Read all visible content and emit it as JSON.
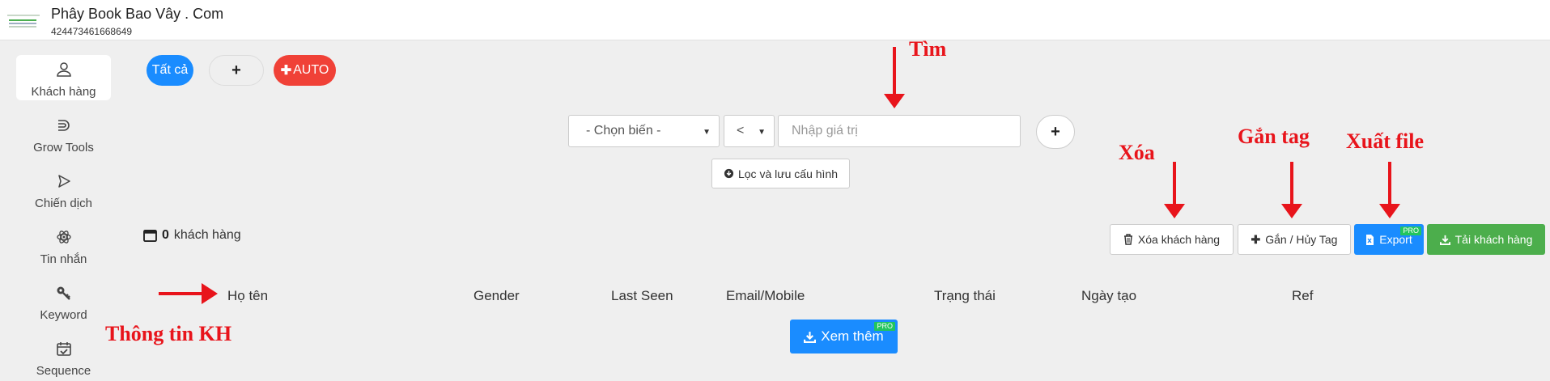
{
  "header": {
    "title": "Phây Book Bao Vây . Com",
    "page_id": "424473461668649"
  },
  "sidebar": {
    "items": [
      {
        "label": "Khách hàng",
        "icon": "user-icon",
        "active": true
      },
      {
        "label": "Grow Tools",
        "icon": "magnet-icon"
      },
      {
        "label": "Chiến dịch",
        "icon": "send-icon"
      },
      {
        "label": "Tin nhắn",
        "icon": "atom-icon"
      },
      {
        "label": "Keyword",
        "icon": "key-icon"
      },
      {
        "label": "Sequence",
        "icon": "calendar-check-icon"
      }
    ]
  },
  "segments": {
    "all": "Tất cả",
    "add": "+",
    "auto": "AUTO"
  },
  "filter": {
    "variable_placeholder": "- Chọn biến -",
    "operator": "<",
    "value_placeholder": "Nhập giá trị",
    "add": "+",
    "save_label": "Lọc và lưu cấu hình"
  },
  "summary": {
    "count": "0",
    "unit": "khách hàng"
  },
  "actions": {
    "delete": "Xóa khách hàng",
    "tag": "Gắn / Hủy Tag",
    "export": "Export",
    "export_badge": "PRO",
    "download": "Tải khách hàng"
  },
  "table": {
    "columns": [
      "Họ tên",
      "Gender",
      "Last Seen",
      "Email/Mobile",
      "Trạng thái",
      "Ngày tạo",
      "Ref"
    ]
  },
  "load_more": {
    "label": "Xem thêm",
    "badge": "PRO"
  },
  "annotations": {
    "search": "Tìm",
    "delete": "Xóa",
    "tag": "Gắn tag",
    "export": "Xuất file",
    "customer_info": "Thông tin KH"
  },
  "colors": {
    "primary": "#1a8cff",
    "danger": "#f04137",
    "success": "#4cae4c",
    "annotation": "#e8141b"
  }
}
